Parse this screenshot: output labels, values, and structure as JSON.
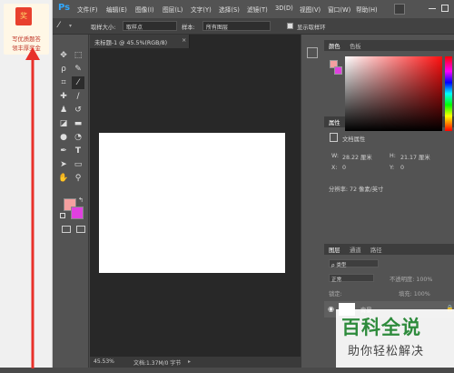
{
  "promo": {
    "badge": "奖",
    "line1": "写优质题答",
    "line2": "领丰厚奖金"
  },
  "app": {
    "logo": "Ps"
  },
  "menu": [
    "文件(F)",
    "编辑(E)",
    "图像(I)",
    "图层(L)",
    "文字(Y)",
    "选择(S)",
    "滤镜(T)",
    "3D(D)",
    "视图(V)",
    "窗口(W)",
    "帮助(H)"
  ],
  "options": {
    "sample_size_label": "取样大小:",
    "sample_size_value": "取样点",
    "sample_label": "样本:",
    "sample_value": "所有图层",
    "show_ring_label": "显示取样环"
  },
  "document": {
    "tab_title": "未标题-1 @ 45.5%(RGB/8)",
    "tab_close": "×",
    "zoom": "45.53%",
    "doc_info": "文档:1.37M/0 字节"
  },
  "colors": {
    "foreground": "#f4a0a0",
    "background": "#e040e0",
    "accent": "#31a8ff"
  },
  "panels": {
    "color_tabs": [
      "颜色",
      "色板"
    ],
    "props_tabs": [
      "属性",
      "调整"
    ],
    "doc_props": "文档属性",
    "w_label": "W:",
    "w_value": "28.22 厘米",
    "h_label": "H:",
    "h_value": "21.17 厘米",
    "x_label": "X:",
    "x_value": "0",
    "y_label": "Y:",
    "y_value": "0",
    "resolution": "分辨率: 72 像素/英寸",
    "layer_tabs": [
      "图层",
      "通道",
      "路径"
    ],
    "kind_label": "ρ 类型",
    "blend_mode": "正常",
    "opacity": "不透明度: 100%",
    "lock_label": "锁定:",
    "fill": "填充: 100%",
    "layer_name": "背景"
  },
  "watermark": {
    "title": "百科全说",
    "subtitle": "助你轻松解决"
  }
}
